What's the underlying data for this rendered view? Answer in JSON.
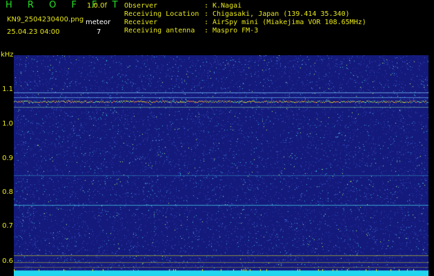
{
  "header": {
    "title": "H R O F F T",
    "version": "1.0.0f",
    "filename": "KN9_2504230400.png",
    "datetime": "25.04.23 04:00",
    "meteor_label": "meteor",
    "meteor_count": "7"
  },
  "info": [
    {
      "label": "Observer",
      "value": "K.Nagai"
    },
    {
      "label": "Receiving Location",
      "value": "Chigasaki, Japan (139.414 35.340)"
    },
    {
      "label": "Receiver",
      "value": "AirSpy mini (Miakejima VOR 108.65MHz)"
    },
    {
      "label": "Receiving antenna",
      "value": "Maspro FM-3"
    }
  ],
  "axes": {
    "y_unit": "kHz",
    "y_ticks": [
      "1.1",
      "1.0",
      "0.9",
      "0.8",
      "0.7",
      "0.6"
    ],
    "x_ticks": [
      "0401",
      "0402",
      "0403",
      "0404",
      "0405",
      "0406",
      "0407",
      "0408",
      "0409",
      "0410"
    ]
  },
  "colors": {
    "background": "#141a7c",
    "label": "#e8e81a",
    "title": "#26e026"
  }
}
